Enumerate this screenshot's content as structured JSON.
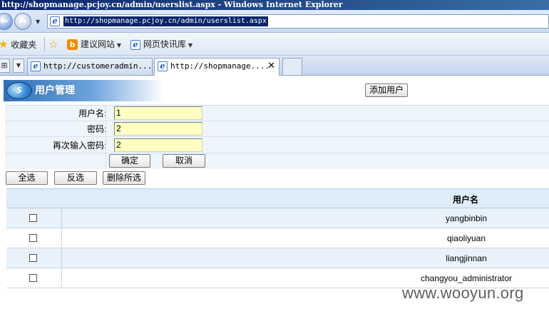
{
  "window": {
    "title": "http://shopmanage.pcjoy.cn/admin/userslist.aspx - Windows Internet Explorer"
  },
  "address_bar": {
    "url": "http://shopmanage.pcjoy.cn/admin/userslist.aspx"
  },
  "favorites_bar": {
    "favorites_label": "收藏夹",
    "items": [
      {
        "label": "建议网站",
        "icon": "b-icon"
      },
      {
        "label": "网页快讯库",
        "icon": "ie-icon"
      }
    ]
  },
  "tabs": [
    {
      "label": "http://customeradmin....",
      "active": false
    },
    {
      "label": "http://shopmanage....",
      "active": true
    }
  ],
  "page": {
    "header_title": "用户管理",
    "add_user_label": "添加用户",
    "form": {
      "fields": [
        {
          "label": "用户名:",
          "value": "1"
        },
        {
          "label": "密码:",
          "value": "2"
        },
        {
          "label": "再次输入密码:",
          "value": "2"
        }
      ],
      "confirm_label": "确定",
      "cancel_label": "取消"
    },
    "toolbar": {
      "select_all_label": "全选",
      "invert_label": "反选",
      "delete_label": "删除所选"
    },
    "grid": {
      "column_header": "用户名",
      "rows": [
        {
          "username": "yangbinbin",
          "checked": false
        },
        {
          "username": "qiaoliyuan",
          "checked": false
        },
        {
          "username": "liangjinnan",
          "checked": false
        },
        {
          "username": "changyou_administrator",
          "checked": false
        }
      ]
    },
    "watermark": "www.wooyun.org"
  }
}
